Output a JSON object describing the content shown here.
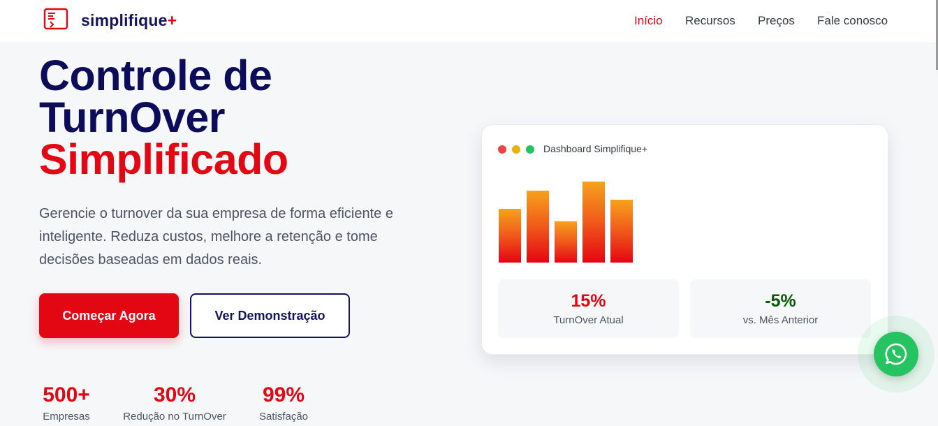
{
  "brand": {
    "name": "simplifique",
    "plus": "+",
    "logo_icon": "document-arrow-icon"
  },
  "nav": {
    "items": [
      {
        "label": "Início",
        "active": true
      },
      {
        "label": "Recursos",
        "active": false
      },
      {
        "label": "Preços",
        "active": false
      },
      {
        "label": "Fale conosco",
        "active": false
      }
    ]
  },
  "hero": {
    "title_line1": "Controle de",
    "title_line2": "TurnOver",
    "title_line3": "Simplificado",
    "subtitle": "Gerencie o turnover da sua empresa de forma eficiente e inteligente. Reduza custos, melhore a retenção e tome decisões baseadas em dados reais.",
    "primary_cta": "Começar Agora",
    "secondary_cta": "Ver Demonstração"
  },
  "stats": [
    {
      "value": "500+",
      "label": "Empresas"
    },
    {
      "value": "30%",
      "label": "Redução no TurnOver"
    },
    {
      "value": "99%",
      "label": "Satisfação"
    }
  ],
  "dashboard": {
    "title": "Dashboard Simplifique+",
    "window_dots": [
      "#ef4444",
      "#eab308",
      "#22c55e"
    ],
    "bar_levels": [
      0.66,
      0.88,
      0.5,
      0.99,
      0.77
    ],
    "bar_gradient": [
      "#f6a21c",
      "#f0591a",
      "#e30613"
    ],
    "metrics": [
      {
        "value": "15%",
        "label": "TurnOver Atual",
        "color": "#e30613"
      },
      {
        "value": "-5%",
        "label": "vs. Mês Anterior",
        "color": "#0a5a0a"
      }
    ]
  },
  "whatsapp": {
    "icon": "whatsapp-icon",
    "color": "#25c460"
  },
  "colors": {
    "accent": "#e30613",
    "navy": "#14145a"
  }
}
